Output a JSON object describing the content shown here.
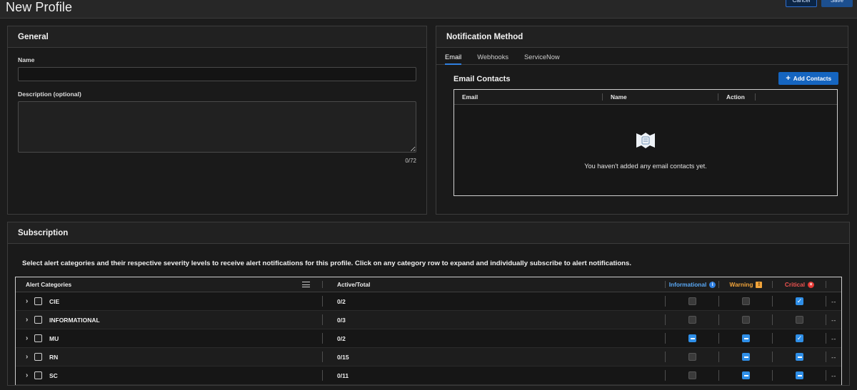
{
  "header": {
    "title": "New Profile",
    "cancel_label": "Cancel",
    "save_label": "Save"
  },
  "general": {
    "panel_title": "General",
    "name_label": "Name",
    "name_value": "",
    "description_label": "Description (optional)",
    "description_value": "",
    "char_counter": "0/72"
  },
  "notification": {
    "panel_title": "Notification Method",
    "tabs": [
      {
        "label": "Email",
        "active": true
      },
      {
        "label": "Webhooks",
        "active": false
      },
      {
        "label": "ServiceNow",
        "active": false
      }
    ],
    "contacts_title": "Email Contacts",
    "add_contacts_label": "Add Contacts",
    "plus_icon": "+",
    "columns": [
      "Email",
      "Name",
      "Action"
    ],
    "empty_state_text": "You haven't added any email contacts yet.",
    "empty_state_icon": "empty-contacts-icon"
  },
  "subscription": {
    "panel_title": "Subscription",
    "description": "Select alert categories and their respective severity levels to receive alert notifications for this profile. Click on any category row to expand and individually subscribe to alert notifications.",
    "columns": {
      "category": "Alert Categories",
      "active_total": "Active/Total",
      "severities": [
        {
          "label": "Informational",
          "icon": "info-icon",
          "glyph": "i",
          "color": "#59a8f5"
        },
        {
          "label": "Warning",
          "icon": "warning-icon",
          "glyph": "!",
          "color": "#f0a33a"
        },
        {
          "label": "Critical",
          "icon": "critical-icon",
          "glyph": "×",
          "color": "#ef5350"
        }
      ]
    },
    "rows": [
      {
        "name": "CIE",
        "active_total": "0/2",
        "selected": false,
        "informational": "unchecked",
        "warning": "unchecked",
        "critical": "checked",
        "tail": "--"
      },
      {
        "name": "INFORMATIONAL",
        "active_total": "0/3",
        "selected": false,
        "informational": "unchecked",
        "warning": "unchecked",
        "critical": "unchecked",
        "tail": "--"
      },
      {
        "name": "MU",
        "active_total": "0/2",
        "selected": false,
        "informational": "indeterminate",
        "warning": "indeterminate",
        "critical": "checked",
        "tail": "--"
      },
      {
        "name": "RN",
        "active_total": "0/15",
        "selected": false,
        "informational": "unchecked",
        "warning": "indeterminate",
        "critical": "indeterminate",
        "tail": "--"
      },
      {
        "name": "SC",
        "active_total": "0/11",
        "selected": false,
        "informational": "unchecked",
        "warning": "indeterminate",
        "critical": "indeterminate",
        "tail": "--"
      }
    ],
    "expand_icon": "›",
    "menu_icon": "hamburger-icon"
  },
  "theme": {
    "accent_blue": "#2f8fe8",
    "warning": "#f0a33a",
    "critical": "#e53935",
    "page_bg": "#1c1c1c"
  }
}
